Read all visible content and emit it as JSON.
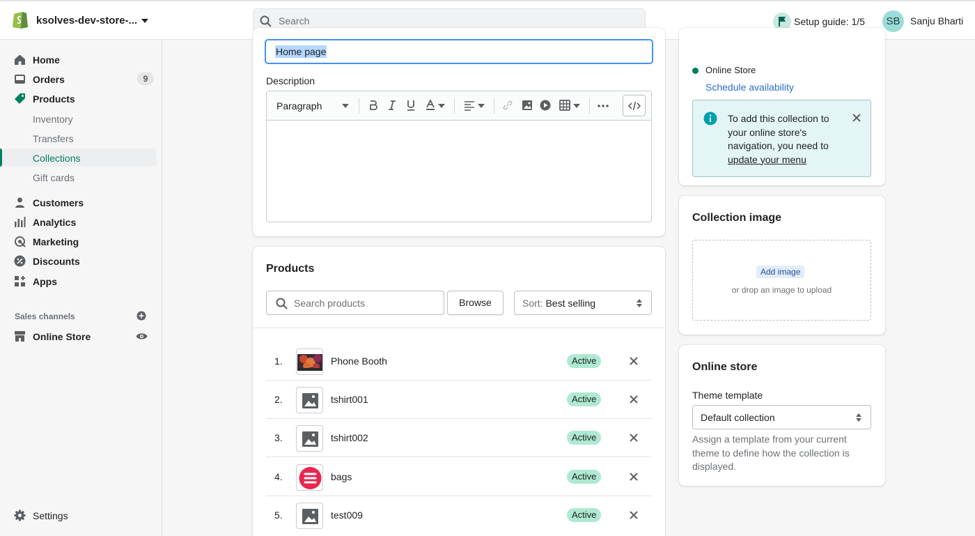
{
  "topbar": {
    "store_name": "ksolves-dev-store-...",
    "search_placeholder": "Search",
    "setup_guide": "Setup guide: 1/5",
    "avatar_initials": "SB",
    "user_name": "Sanju Bharti"
  },
  "sidebar": {
    "items": [
      {
        "label": "Home"
      },
      {
        "label": "Orders",
        "badge": "9"
      },
      {
        "label": "Products"
      },
      {
        "label": "Inventory"
      },
      {
        "label": "Transfers"
      },
      {
        "label": "Collections"
      },
      {
        "label": "Gift cards"
      },
      {
        "label": "Customers"
      },
      {
        "label": "Analytics"
      },
      {
        "label": "Marketing"
      },
      {
        "label": "Discounts"
      },
      {
        "label": "Apps"
      }
    ],
    "sales_channels_heading": "Sales channels",
    "online_store": "Online Store",
    "settings": "Settings"
  },
  "main": {
    "title_value": "Home page",
    "description_label": "Description",
    "editor": {
      "paragraph": "Paragraph"
    },
    "products": {
      "heading": "Products",
      "search_placeholder": "Search products",
      "browse": "Browse",
      "sort_prefix": "Sort:",
      "sort_value": "Best selling",
      "rows": [
        {
          "num": "1.",
          "name": "Phone Booth",
          "status": "Active"
        },
        {
          "num": "2.",
          "name": "tshirt001",
          "status": "Active"
        },
        {
          "num": "3.",
          "name": "tshirt002",
          "status": "Active"
        },
        {
          "num": "4.",
          "name": "bags",
          "status": "Active"
        },
        {
          "num": "5.",
          "name": "test009",
          "status": "Active"
        }
      ]
    }
  },
  "right": {
    "availability": {
      "channel": "Online Store",
      "schedule_link": "Schedule availability",
      "banner_text": "To add this collection to your online store's navigation, you need to",
      "banner_link": "update your menu"
    },
    "collection_image": {
      "heading": "Collection image",
      "add_image": "Add image",
      "drop_hint": "or drop an image to upload"
    },
    "online_store": {
      "heading": "Online store",
      "theme_template_label": "Theme template",
      "theme_template_value": "Default collection",
      "help": "Assign a template from your current theme to define how the collection is displayed."
    }
  },
  "colors": {
    "accent": "#008060",
    "status_active": "#aee9d1",
    "link": "#2c6ecb",
    "focus": "#458fff"
  }
}
